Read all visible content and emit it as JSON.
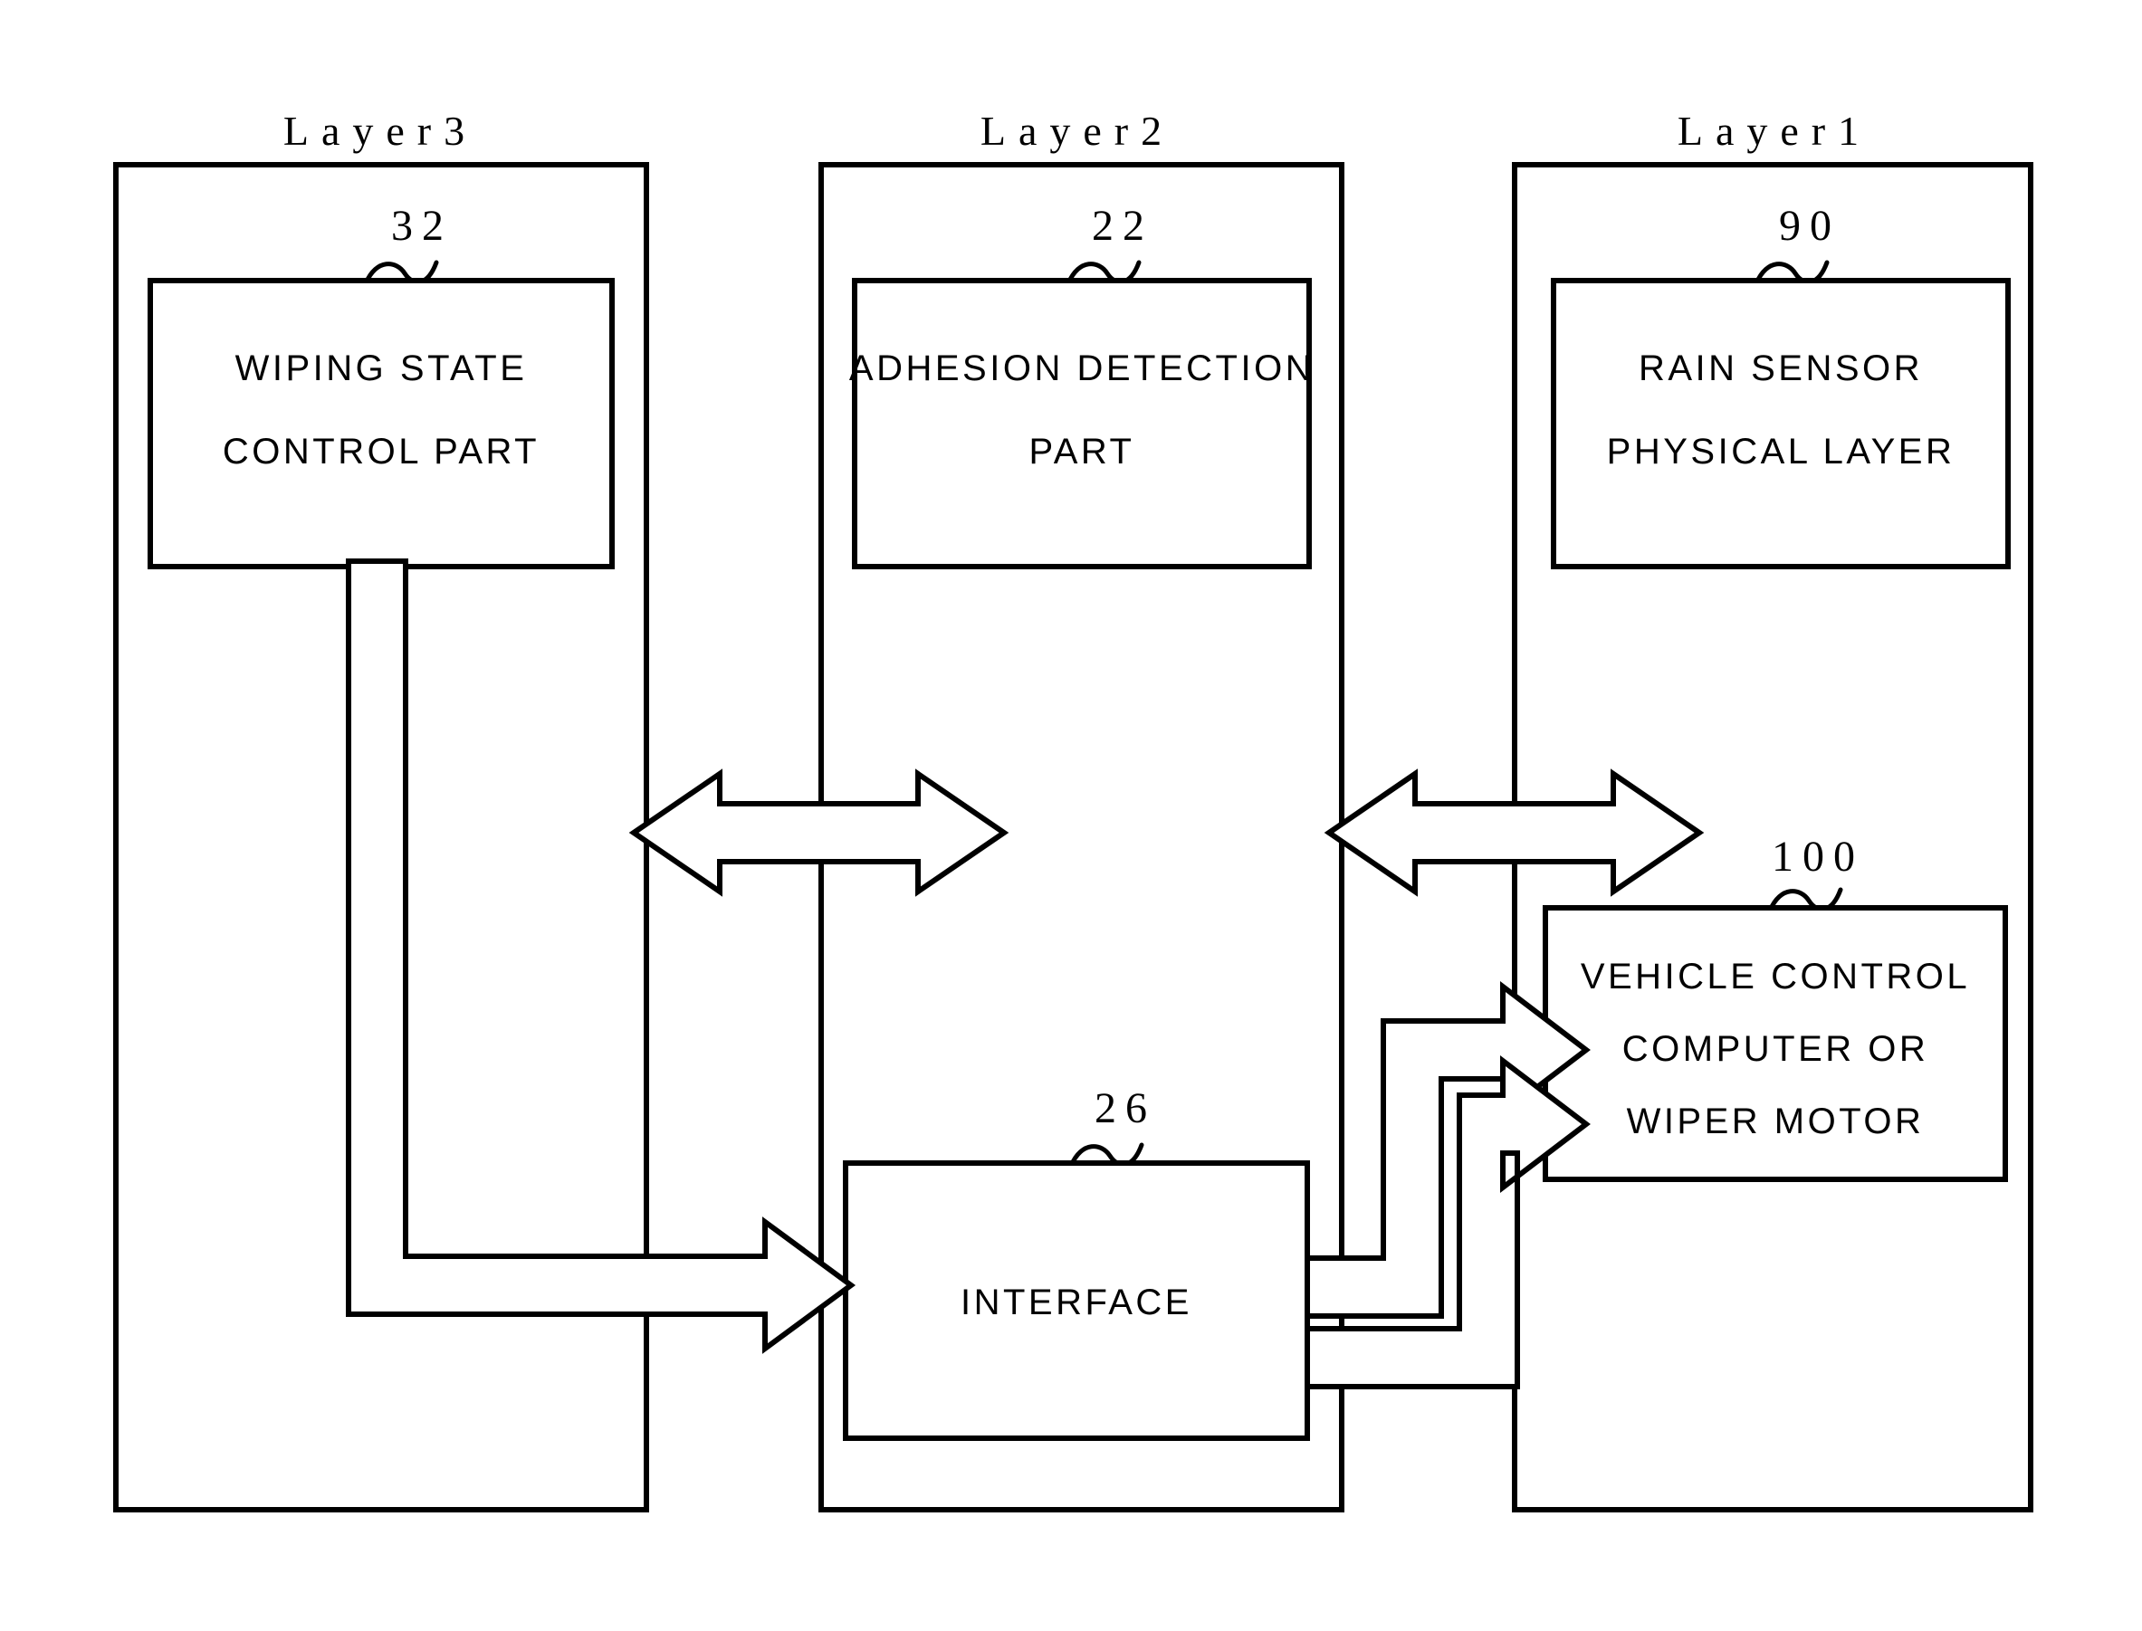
{
  "figure": {
    "title": "Layered rain sensor architecture block diagram",
    "background_color": "#ffffff",
    "line_color": "#000000"
  },
  "layers": [
    {
      "id": "layer3",
      "title": "Layer3",
      "boxes": [
        {
          "id": "wiping-state-control-part",
          "ref": "32",
          "lines": [
            "WIPING STATE",
            "CONTROL PART"
          ]
        }
      ]
    },
    {
      "id": "layer2",
      "title": "Layer2",
      "boxes": [
        {
          "id": "adhesion-detection-part",
          "ref": "22",
          "lines": [
            "ADHESION DETECTION",
            "PART"
          ]
        },
        {
          "id": "interface",
          "ref": "26",
          "lines": [
            "INTERFACE"
          ]
        }
      ]
    },
    {
      "id": "layer1",
      "title": "Layer1",
      "boxes": [
        {
          "id": "rain-sensor-physical-layer",
          "ref": "90",
          "lines": [
            "RAIN SENSOR",
            "PHYSICAL LAYER"
          ]
        },
        {
          "id": "vehicle-control-computer-or-wiper-motor",
          "ref": "100",
          "lines": [
            "VEHICLE CONTROL",
            "COMPUTER OR",
            "WIPER MOTOR"
          ]
        }
      ]
    }
  ],
  "connectors": [
    {
      "id": "layer3-layer2-bidirectional",
      "kind": "double-headed-hollow-arrow",
      "from": "Layer3",
      "to": "Layer2"
    },
    {
      "id": "layer2-layer1-bidirectional",
      "kind": "double-headed-hollow-arrow",
      "from": "Layer2",
      "to": "Layer1"
    },
    {
      "id": "wiping-state-to-interface",
      "kind": "stepped-hollow-block-arrow",
      "from": "WIPING STATE CONTROL PART",
      "to": "INTERFACE"
    },
    {
      "id": "interface-to-vehicle-control-upper",
      "kind": "stepped-hollow-block-arrow",
      "from": "INTERFACE",
      "to": "VEHICLE CONTROL COMPUTER OR WIPER MOTOR"
    },
    {
      "id": "interface-to-vehicle-control-lower",
      "kind": "stepped-hollow-block-arrow",
      "from": "INTERFACE",
      "to": "VEHICLE CONTROL COMPUTER OR WIPER MOTOR"
    }
  ]
}
